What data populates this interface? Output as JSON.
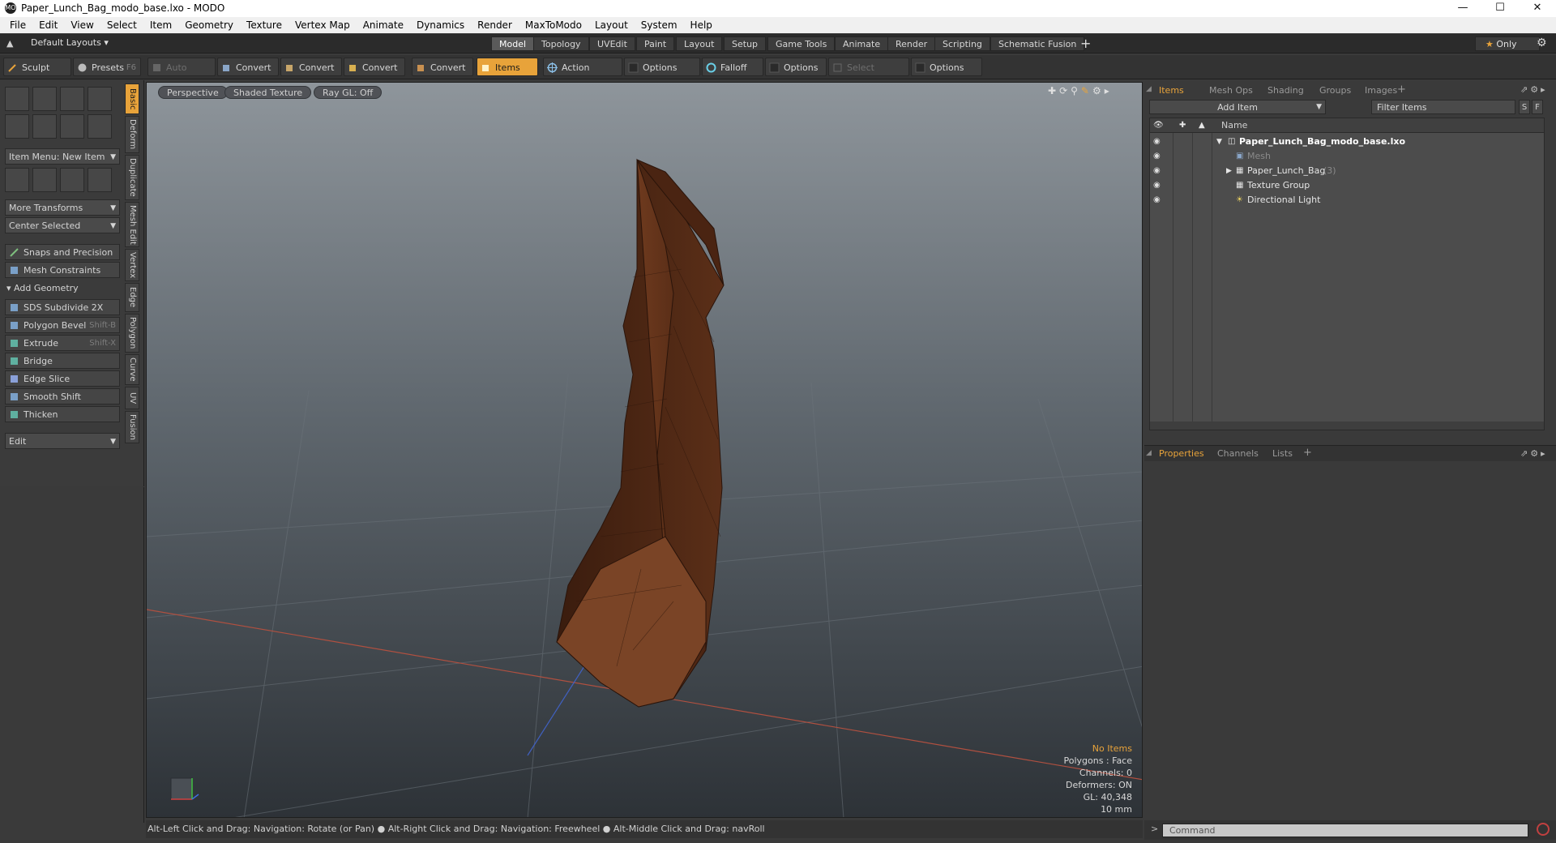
{
  "window": {
    "title": "Paper_Lunch_Bag_modo_base.lxo - MODO",
    "app_icon": "MO"
  },
  "menu": [
    "File",
    "Edit",
    "View",
    "Select",
    "Item",
    "Geometry",
    "Texture",
    "Vertex Map",
    "Animate",
    "Dynamics",
    "Render",
    "MaxToModo",
    "Layout",
    "System",
    "Help"
  ],
  "layoutbar": {
    "layouts_label": "Default Layouts",
    "tabs": [
      "Model",
      "Topology",
      "UVEdit",
      "Paint",
      "Layout",
      "Setup",
      "Game Tools",
      "Animate",
      "Render",
      "Scripting",
      "Schematic Fusion"
    ],
    "active_tab": "Model",
    "only_label": "Only"
  },
  "toolbar": {
    "sculpt": "Sculpt",
    "presets": "Presets",
    "presets_shortcut": "F6",
    "auto_select": "Auto Select",
    "convert1": "Convert",
    "convert2": "Convert",
    "convert3": "Convert",
    "convert4": "Convert",
    "items": "Items",
    "action_center": "Action Center",
    "options1": "Options",
    "falloff": "Falloff",
    "options2": "Options",
    "select_through": "Select Through",
    "options3": "Options"
  },
  "leftpanel": {
    "item_menu": "Item Menu: New Item",
    "more_transforms": "More Transforms",
    "center_selected": "Center Selected",
    "snaps": "Snaps and Precision",
    "mesh_constraints": "Mesh Constraints",
    "add_geometry": "Add Geometry",
    "tools": [
      {
        "label": "SDS Subdivide 2X",
        "shortcut": ""
      },
      {
        "label": "Polygon Bevel",
        "shortcut": "Shift-B"
      },
      {
        "label": "Extrude",
        "shortcut": "Shift-X"
      },
      {
        "label": "Bridge",
        "shortcut": ""
      },
      {
        "label": "Edge Slice",
        "shortcut": ""
      },
      {
        "label": "Smooth Shift",
        "shortcut": ""
      },
      {
        "label": "Thicken",
        "shortcut": ""
      }
    ],
    "edit": "Edit",
    "vtabs": [
      "Basic",
      "Deform",
      "Duplicate",
      "Mesh Edit",
      "Vertex",
      "Edge",
      "Polygon",
      "Curve",
      "UV",
      "Fusion"
    ]
  },
  "viewport": {
    "buttons": [
      "Perspective",
      "Shaded Texture",
      "Ray GL: Off"
    ],
    "info": {
      "no_items": "No Items",
      "polygons": "Polygons : Face",
      "channels": "Channels: 0",
      "deformers": "Deformers: ON",
      "gl": "GL: 40,348",
      "scale": "10 mm"
    },
    "colors": {
      "no_items": "#e8a33a",
      "bag": "#5b2f18"
    }
  },
  "statusbar": "Alt-Left Click and Drag: Navigation: Rotate (or Pan) ● Alt-Right Click and Drag: Navigation: Freewheel ● Alt-Middle Click and Drag: navRoll",
  "rightpanel": {
    "tabs": [
      "Items",
      "Mesh Ops",
      "Shading",
      "Groups",
      "Images"
    ],
    "add_item": "Add Item",
    "filter": "Filter Items",
    "filter_s": "S",
    "filter_f": "F",
    "name_header": "Name",
    "tree": [
      {
        "label": "Paper_Lunch_Bag_modo_base.lxo",
        "indent": 0
      },
      {
        "label": "Mesh",
        "indent": 1
      },
      {
        "label": "Paper_Lunch_Bag",
        "count": "(3)",
        "indent": 1
      },
      {
        "label": "Texture Group",
        "indent": 1
      },
      {
        "label": "Directional Light",
        "indent": 1
      }
    ],
    "prop_tabs": [
      "Properties",
      "Channels",
      "Lists"
    ],
    "command_placeholder": "Command"
  }
}
